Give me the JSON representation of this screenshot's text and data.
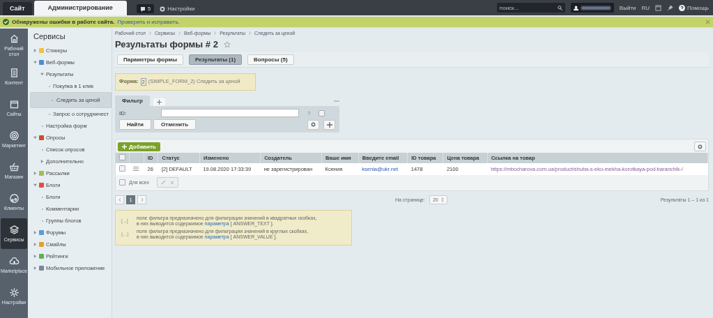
{
  "top_bar": {
    "tabs": [
      {
        "label": "Сайт",
        "selected": false
      },
      {
        "label": "Администрирование",
        "selected": true
      }
    ],
    "updates_badge": "5",
    "settings": "Настройки",
    "search": {
      "placeholder": "поиск..."
    },
    "logout": "Выйти",
    "language": "RU",
    "help": "Помощь"
  },
  "notice": {
    "message": "Обнаружены ошибки в работе сайта.",
    "link": "Проверить и исправить."
  },
  "nav": [
    {
      "label": "Рабочий стол",
      "selected": false
    },
    {
      "label": "Контент",
      "selected": false
    },
    {
      "label": "Сайты",
      "selected": false
    },
    {
      "label": "Маркетинг",
      "selected": false
    },
    {
      "label": "Магазин",
      "selected": false
    },
    {
      "label": "Клиенты",
      "selected": false
    },
    {
      "label": "Сервисы",
      "selected": true
    },
    {
      "label": "Marketplace",
      "selected": false
    },
    {
      "label": "Настройки",
      "selected": false
    }
  ],
  "sidebar": {
    "title": "Сервисы",
    "items": [
      {
        "label": "Стикеры",
        "color": "#f0c040",
        "expanded": false,
        "selected": false
      },
      {
        "label": "Веб-формы",
        "color": "#4a90d0",
        "expanded": true,
        "selected": false,
        "children": [
          {
            "label": "Результаты",
            "expanded": true,
            "selected": false,
            "children": [
              {
                "label": "Покупка в 1 клик",
                "selected": false
              },
              {
                "label": "Следить за ценой",
                "selected": true
              },
              {
                "label": "Запрос о сотрудничест",
                "selected": false
              }
            ]
          },
          {
            "label": "Настройка форм",
            "selected": false
          }
        ]
      },
      {
        "label": "Опросы",
        "color": "#d04a30",
        "expanded": true,
        "selected": false,
        "children": [
          {
            "label": "Список опросов",
            "selected": false
          },
          {
            "label": "Дополнительно",
            "expanded": false,
            "selected": false
          }
        ]
      },
      {
        "label": "Рассылки",
        "color": "#9cc050",
        "expanded": false,
        "selected": false
      },
      {
        "label": "Блоги",
        "color": "#e05040",
        "expanded": true,
        "selected": false,
        "children": [
          {
            "label": "Блоги",
            "selected": false
          },
          {
            "label": "Комментарии",
            "selected": false
          },
          {
            "label": "Группы блогов",
            "selected": false
          }
        ]
      },
      {
        "label": "Форумы",
        "color": "#5a9ad8",
        "expanded": false,
        "selected": false
      },
      {
        "label": "Смайлы",
        "color": "#e8a020",
        "expanded": false,
        "selected": false
      },
      {
        "label": "Рейтинги",
        "color": "#60b050",
        "expanded": false,
        "selected": false
      },
      {
        "label": "Мобильное приложение",
        "color": "#7a8898",
        "expanded": false,
        "selected": false
      }
    ]
  },
  "breadcrumbs": [
    "Рабочий стол",
    "Сервисы",
    "Веб-формы",
    "Результаты",
    "Следить за ценой"
  ],
  "page_title": "Результаты формы # 2",
  "tabs": [
    {
      "label": "Параметры формы",
      "selected": false
    },
    {
      "label": "Результаты (1)",
      "selected": true
    },
    {
      "label": "Вопросы (5)",
      "selected": false
    }
  ],
  "form_note": {
    "label": "Форма:",
    "id_link": "2",
    "text": "(SIMPLE_FORM_2) Следить за ценой"
  },
  "filter": {
    "tab": "Фильтр",
    "field_label": "ID:",
    "hint": "?",
    "checked": false,
    "find": "Найти",
    "cancel": "Отменить"
  },
  "add_button": "Добавить",
  "table": {
    "all_checked": false,
    "columns": [
      "ID",
      "Статус",
      "Изменено",
      "Создатель",
      "Ваше имя",
      "Введите email",
      "ID товара",
      "Цена товара",
      "Ссылка на товар"
    ],
    "rows": [
      {
        "checked": false,
        "cells": [
          "26",
          "[2] DEFAULT",
          "19.08.2020 17:33:39",
          "не зарегистрирован",
          "Ксения",
          "ksenia@ukr.net",
          "1478",
          "2100",
          "https://mbocharova.com.ua/product/shuba-s-eko-mekha-korotkaya-pod-baranchik-/"
        ]
      }
    ],
    "for_all": "Для всех",
    "for_all_checked": false
  },
  "pager": {
    "pages": [
      {
        "label": "1",
        "selected": true
      }
    ],
    "per_page_label": "На странице:",
    "per_page": "20",
    "results": "Результаты 1 – 1 из 1"
  },
  "help": [
    {
      "mark": "[...]",
      "text": "поле фильтра предназначено для фильтрации значений в квадратных скобках,",
      "text2": "в них выводится содержимое",
      "link": "параметра",
      "tail": "[ ANSWER_TEXT ]."
    },
    {
      "mark": "(...)",
      "text": "поле фильтра предназначено для фильтрации значений в круглых скобках,",
      "text2": "в них выводится содержимое",
      "link": "параметра",
      "tail": "[ ANSWER_VALUE ]."
    }
  ]
}
